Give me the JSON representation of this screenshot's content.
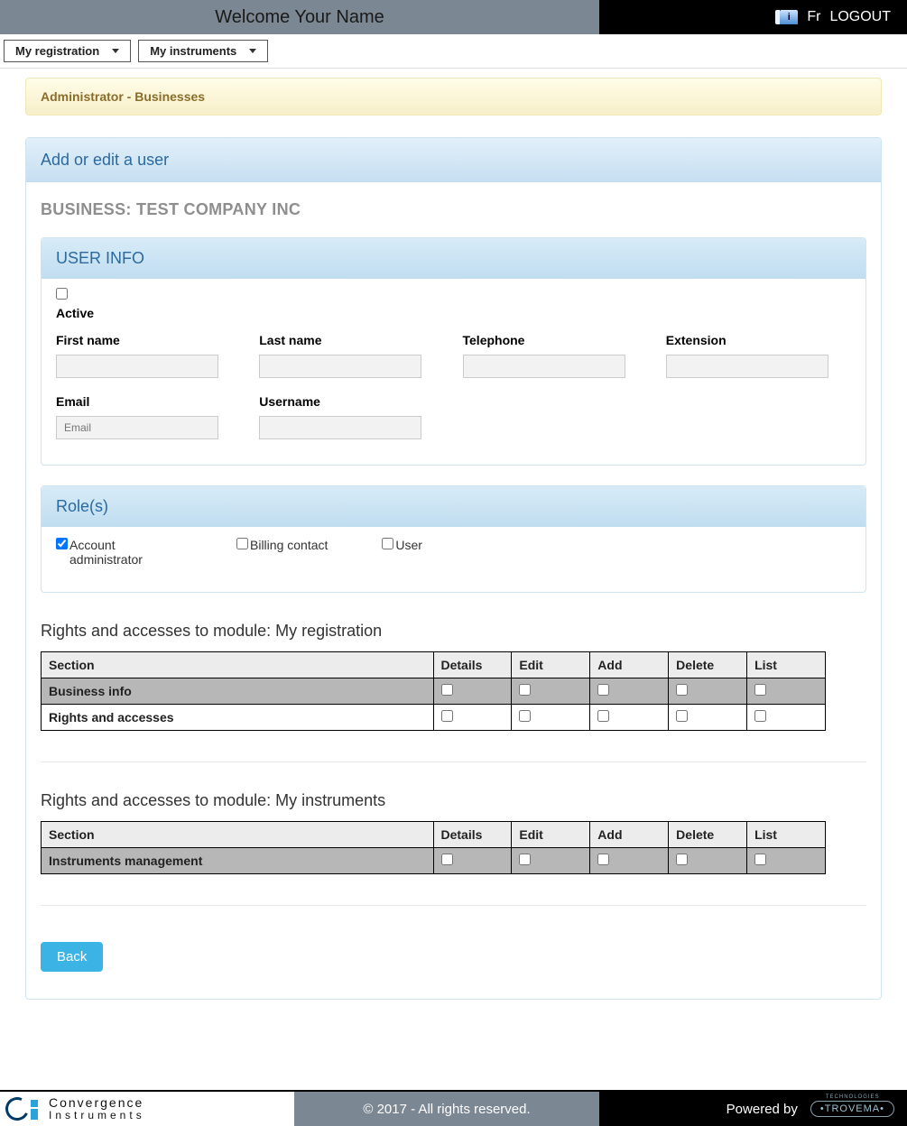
{
  "topbar": {
    "welcome": "Welcome  Your Name",
    "lang": "Fr",
    "logout": "LOGOUT"
  },
  "menus": {
    "registration": "My registration",
    "instruments": "My instruments"
  },
  "breadcrumb": "Administrator - Businesses",
  "panel_title": "Add or edit a user",
  "business_line_prefix": "BUSINESS: ",
  "business_name": "TEST COMPANY INC",
  "user_info": {
    "header": "USER INFO",
    "active_label": "Active",
    "first_name_label": "First name",
    "last_name_label": "Last name",
    "telephone_label": "Telephone",
    "extension_label": "Extension",
    "email_label": "Email",
    "email_placeholder": "Email",
    "username_label": "Username"
  },
  "roles": {
    "header": "Role(s)",
    "items": [
      {
        "label": "Account administrator",
        "checked": true
      },
      {
        "label": "Billing contact",
        "checked": false
      },
      {
        "label": "User",
        "checked": false
      }
    ]
  },
  "rights1": {
    "title": "Rights and accesses to module: My registration",
    "columns": [
      "Section",
      "Details",
      "Edit",
      "Add",
      "Delete",
      "List"
    ],
    "rows": [
      {
        "section": "Business info",
        "shaded": true
      },
      {
        "section": "Rights and accesses",
        "shaded": false
      }
    ]
  },
  "rights2": {
    "title": "Rights and accesses to module: My instruments",
    "columns": [
      "Section",
      "Details",
      "Edit",
      "Add",
      "Delete",
      "List"
    ],
    "rows": [
      {
        "section": "Instruments management",
        "shaded": true
      }
    ]
  },
  "back_button": "Back",
  "footer": {
    "brand_top": "Convergence",
    "brand_bottom": "Instruments",
    "copyright": "© 2017 - All rights reserved.",
    "powered": "Powered by",
    "trovema": "•TROVEMA•"
  }
}
